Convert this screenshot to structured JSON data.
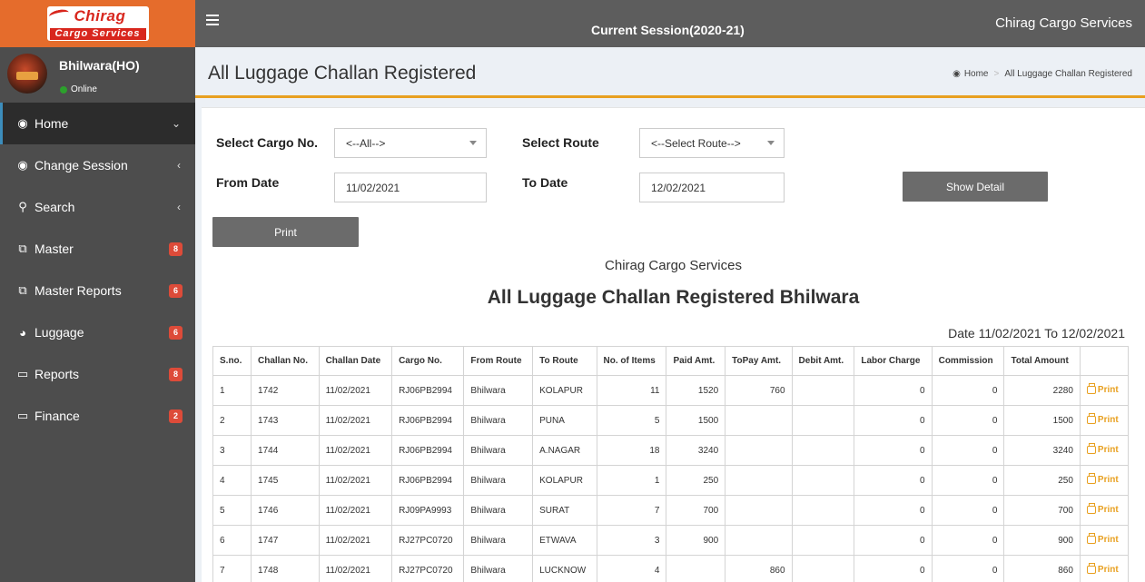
{
  "logo": {
    "brand": "Chirag",
    "subtitle": "Cargo Services"
  },
  "header": {
    "session": "Current Session(2020-21)",
    "company": "Chirag Cargo Services"
  },
  "user": {
    "name": "Bhilwara(HO)",
    "status": "Online"
  },
  "sidebar": {
    "items": [
      {
        "label": "Home",
        "icon": "dashboard-icon",
        "indicator": "chevron-down",
        "badge": ""
      },
      {
        "label": "Change Session",
        "icon": "dashboard-icon",
        "indicator": "chevron-left",
        "badge": ""
      },
      {
        "label": "Search",
        "icon": "search-icon",
        "indicator": "chevron-left",
        "badge": ""
      },
      {
        "label": "Master",
        "icon": "copy-icon",
        "indicator": "",
        "badge": "8"
      },
      {
        "label": "Master Reports",
        "icon": "copy-icon",
        "indicator": "",
        "badge": "6"
      },
      {
        "label": "Luggage",
        "icon": "pie-chart-icon",
        "indicator": "",
        "badge": "6"
      },
      {
        "label": "Reports",
        "icon": "laptop-icon",
        "indicator": "",
        "badge": "8"
      },
      {
        "label": "Finance",
        "icon": "laptop-icon",
        "indicator": "",
        "badge": "2"
      }
    ]
  },
  "page": {
    "title": "All Luggage Challan Registered",
    "breadcrumb": {
      "home": "Home",
      "current": "All Luggage Challan Registered"
    }
  },
  "filters": {
    "cargo_label": "Select Cargo No.",
    "cargo_value": "<--All-->",
    "route_label": "Select Route",
    "route_value": "<--Select Route-->",
    "from_label": "From Date",
    "from_value": "11/02/2021",
    "to_label": "To Date",
    "to_value": "12/02/2021",
    "show_button": "Show Detail",
    "print_button": "Print"
  },
  "report": {
    "company": "Chirag Cargo Services",
    "title": "All Luggage Challan Registered Bhilwara",
    "range": "Date 11/02/2021 To 12/02/2021"
  },
  "table": {
    "columns": [
      "S.no.",
      "Challan No.",
      "Challan Date",
      "Cargo No.",
      "From Route",
      "To Route",
      "No. of Items",
      "Paid Amt.",
      "ToPay Amt.",
      "Debit Amt.",
      "Labor Charge",
      "Commission",
      "Total Amount",
      ""
    ],
    "print_label": "Print",
    "rows": [
      [
        "1",
        "1742",
        "11/02/2021",
        "RJ06PB2994",
        "Bhilwara",
        "KOLAPUR",
        "11",
        "1520",
        "760",
        "",
        "0",
        "0",
        "2280"
      ],
      [
        "2",
        "1743",
        "11/02/2021",
        "RJ06PB2994",
        "Bhilwara",
        "PUNA",
        "5",
        "1500",
        "",
        "",
        "0",
        "0",
        "1500"
      ],
      [
        "3",
        "1744",
        "11/02/2021",
        "RJ06PB2994",
        "Bhilwara",
        "A.NAGAR",
        "18",
        "3240",
        "",
        "",
        "0",
        "0",
        "3240"
      ],
      [
        "4",
        "1745",
        "11/02/2021",
        "RJ06PB2994",
        "Bhilwara",
        "KOLAPUR",
        "1",
        "250",
        "",
        "",
        "0",
        "0",
        "250"
      ],
      [
        "5",
        "1746",
        "11/02/2021",
        "RJ09PA9993",
        "Bhilwara",
        "SURAT",
        "7",
        "700",
        "",
        "",
        "0",
        "0",
        "700"
      ],
      [
        "6",
        "1747",
        "11/02/2021",
        "RJ27PC0720",
        "Bhilwara",
        "ETWAVA",
        "3",
        "900",
        "",
        "",
        "0",
        "0",
        "900"
      ],
      [
        "7",
        "1748",
        "11/02/2021",
        "RJ27PC0720",
        "Bhilwara",
        "LUCKNOW",
        "4",
        "",
        "860",
        "",
        "0",
        "0",
        "860"
      ]
    ]
  },
  "colors": {
    "accent": "#e8a020",
    "topbar": "#5d5d5d",
    "sidebar": "#4d4d4d",
    "logo_bg": "#e56c2c",
    "badge": "#dd4b39"
  }
}
